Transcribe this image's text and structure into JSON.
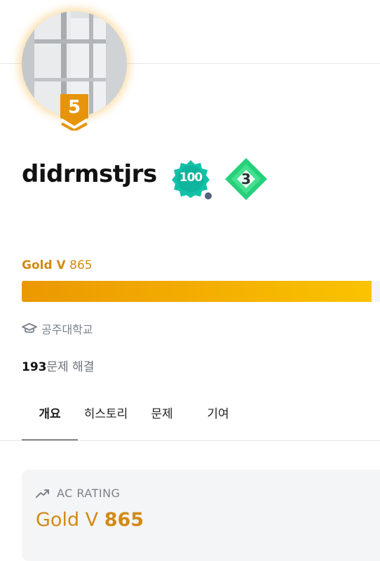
{
  "profile": {
    "tier_level": "5",
    "username": "didrmstjrs",
    "class_badge": "100",
    "streak_badge": "3",
    "tier_name": "Gold V",
    "rating": "865",
    "tier_progress": 0.96,
    "school": "공주대학교",
    "solved_count": "193",
    "solved_suffix": "문제 해결"
  },
  "tabs": [
    "개요",
    "히스토리",
    "문제",
    "기여"
  ],
  "rating_card": {
    "label": "AC RATING",
    "tier_name": "Gold V",
    "rating": "865"
  },
  "icons": {
    "school": "graduation-cap-icon",
    "rating": "trending-up-icon"
  },
  "colors": {
    "gold": "#d28a15",
    "progress_start": "#eb9800",
    "progress_end": "#fbc300",
    "class_badge": "#12c2a8",
    "streak_badge": "#27d07a"
  }
}
